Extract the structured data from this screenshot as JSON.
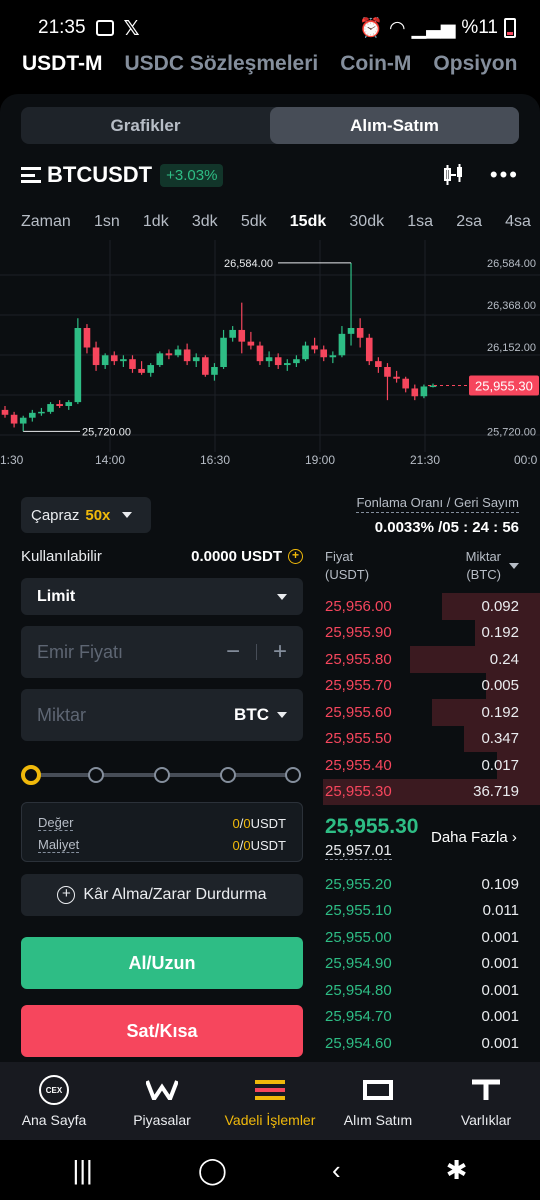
{
  "status_bar": {
    "time": "21:35",
    "battery_text": "%11"
  },
  "market_tabs": [
    "USDT-M",
    "USDC Sözleşmeleri",
    "Coin-M",
    "Opsiyon"
  ],
  "view_toggle": {
    "charts": "Grafikler",
    "trade": "Alım-Satım"
  },
  "pair": {
    "name": "BTCUSDT",
    "change": "+3.03%"
  },
  "intervals": [
    "Zaman",
    "1sn",
    "1dk",
    "3dk",
    "5dk",
    "15dk",
    "30dk",
    "1sa",
    "2sa",
    "4sa"
  ],
  "active_interval": "15dk",
  "chart_data": {
    "type": "candlestick",
    "y_ticks": [
      "26,584.00",
      "26,368.00",
      "26,152.00",
      "25,720.00"
    ],
    "x_ticks": [
      "1:30",
      "14:00",
      "16:30",
      "19:00",
      "21:30",
      "00:0"
    ],
    "high_label": "26,584.00",
    "low_label": "25,720.00",
    "last_price_label": "25,955.30",
    "ylim": [
      25650,
      26650
    ],
    "candles": [
      {
        "o": 25830,
        "h": 25850,
        "l": 25790,
        "c": 25805
      },
      {
        "o": 25805,
        "h": 25820,
        "l": 25740,
        "c": 25760
      },
      {
        "o": 25760,
        "h": 25800,
        "l": 25720,
        "c": 25790
      },
      {
        "o": 25790,
        "h": 25830,
        "l": 25770,
        "c": 25815
      },
      {
        "o": 25815,
        "h": 25840,
        "l": 25800,
        "c": 25820
      },
      {
        "o": 25820,
        "h": 25870,
        "l": 25810,
        "c": 25860
      },
      {
        "o": 25860,
        "h": 25880,
        "l": 25840,
        "c": 25850
      },
      {
        "o": 25850,
        "h": 25880,
        "l": 25830,
        "c": 25870
      },
      {
        "o": 25870,
        "h": 26300,
        "l": 25860,
        "c": 26250
      },
      {
        "o": 26250,
        "h": 26270,
        "l": 26120,
        "c": 26150
      },
      {
        "o": 26150,
        "h": 26180,
        "l": 26030,
        "c": 26060
      },
      {
        "o": 26060,
        "h": 26120,
        "l": 26040,
        "c": 26110
      },
      {
        "o": 26110,
        "h": 26130,
        "l": 26060,
        "c": 26080
      },
      {
        "o": 26080,
        "h": 26110,
        "l": 26050,
        "c": 26090
      },
      {
        "o": 26090,
        "h": 26110,
        "l": 26020,
        "c": 26040
      },
      {
        "o": 26040,
        "h": 26080,
        "l": 26010,
        "c": 26020
      },
      {
        "o": 26020,
        "h": 26070,
        "l": 26000,
        "c": 26060
      },
      {
        "o": 26060,
        "h": 26130,
        "l": 26050,
        "c": 26120
      },
      {
        "o": 26120,
        "h": 26140,
        "l": 26090,
        "c": 26110
      },
      {
        "o": 26110,
        "h": 26160,
        "l": 26100,
        "c": 26140
      },
      {
        "o": 26140,
        "h": 26170,
        "l": 26060,
        "c": 26080
      },
      {
        "o": 26080,
        "h": 26120,
        "l": 26050,
        "c": 26100
      },
      {
        "o": 26100,
        "h": 26110,
        "l": 26000,
        "c": 26010
      },
      {
        "o": 26010,
        "h": 26070,
        "l": 25980,
        "c": 26050
      },
      {
        "o": 26050,
        "h": 26240,
        "l": 26040,
        "c": 26200
      },
      {
        "o": 26200,
        "h": 26260,
        "l": 26180,
        "c": 26240
      },
      {
        "o": 26240,
        "h": 26380,
        "l": 26120,
        "c": 26180
      },
      {
        "o": 26180,
        "h": 26230,
        "l": 26140,
        "c": 26160
      },
      {
        "o": 26160,
        "h": 26180,
        "l": 26060,
        "c": 26080
      },
      {
        "o": 26080,
        "h": 26130,
        "l": 26050,
        "c": 26100
      },
      {
        "o": 26100,
        "h": 26120,
        "l": 26040,
        "c": 26060
      },
      {
        "o": 26060,
        "h": 26090,
        "l": 26030,
        "c": 26070
      },
      {
        "o": 26070,
        "h": 26110,
        "l": 26050,
        "c": 26090
      },
      {
        "o": 26090,
        "h": 26180,
        "l": 26080,
        "c": 26160
      },
      {
        "o": 26160,
        "h": 26200,
        "l": 26120,
        "c": 26140
      },
      {
        "o": 26140,
        "h": 26160,
        "l": 26080,
        "c": 26100
      },
      {
        "o": 26100,
        "h": 26130,
        "l": 26070,
        "c": 26110
      },
      {
        "o": 26110,
        "h": 26260,
        "l": 26100,
        "c": 26220
      },
      {
        "o": 26220,
        "h": 26584,
        "l": 26160,
        "c": 26250
      },
      {
        "o": 26250,
        "h": 26300,
        "l": 26150,
        "c": 26200
      },
      {
        "o": 26200,
        "h": 26220,
        "l": 26060,
        "c": 26080
      },
      {
        "o": 26080,
        "h": 26100,
        "l": 26020,
        "c": 26050
      },
      {
        "o": 26050,
        "h": 26070,
        "l": 25880,
        "c": 26000
      },
      {
        "o": 26000,
        "h": 26030,
        "l": 25970,
        "c": 25990
      },
      {
        "o": 25990,
        "h": 26000,
        "l": 25920,
        "c": 25940
      },
      {
        "o": 25940,
        "h": 25960,
        "l": 25880,
        "c": 25900
      },
      {
        "o": 25900,
        "h": 25960,
        "l": 25890,
        "c": 25950
      },
      {
        "o": 25950,
        "h": 25965,
        "l": 25945,
        "c": 25955
      }
    ]
  },
  "margin": {
    "mode": "Çapraz",
    "leverage": "50x"
  },
  "funding": {
    "label": "Fonlama Oranı / Geri Sayım",
    "value": "0.0033% /05 : 24 : 56"
  },
  "available": {
    "label": "Kullanılabilir",
    "value": "0.0000 USDT"
  },
  "order_type": "Limit",
  "price_input": {
    "placeholder": "Emir Fiyatı",
    "minus": "−",
    "plus": "+"
  },
  "qty_input": {
    "placeholder": "Miktar",
    "unit": "BTC"
  },
  "slider_percent": 0,
  "summary": [
    {
      "label": "Değer",
      "value": "0",
      "value2": "0",
      "unit": "USDT"
    },
    {
      "label": "Maliyet",
      "value": "0",
      "value2": "0",
      "unit": "USDT"
    }
  ],
  "tpsl_label": "Kâr Alma/Zarar Durdurma",
  "buy_label": "Al/Uzun",
  "sell_label": "Sat/Kısa",
  "orderbook": {
    "price_header": "Fiyat",
    "price_unit": "(USDT)",
    "qty_header": "Miktar",
    "qty_unit": "(BTC)",
    "asks": [
      {
        "price": "25,956.00",
        "qty": "0.092",
        "depth": 0.45
      },
      {
        "price": "25,955.90",
        "qty": "0.192",
        "depth": 0.3
      },
      {
        "price": "25,955.80",
        "qty": "0.24",
        "depth": 0.6
      },
      {
        "price": "25,955.70",
        "qty": "0.005",
        "depth": 0.25
      },
      {
        "price": "25,955.60",
        "qty": "0.192",
        "depth": 0.5
      },
      {
        "price": "25,955.50",
        "qty": "0.347",
        "depth": 0.35
      },
      {
        "price": "25,955.40",
        "qty": "0.017",
        "depth": 0.2
      },
      {
        "price": "25,955.30",
        "qty": "36.719",
        "depth": 1.0
      }
    ],
    "last_price": "25,955.30",
    "mark_price": "25,957.01",
    "more_label": "Daha Fazla",
    "bids": [
      {
        "price": "25,955.20",
        "qty": "0.109"
      },
      {
        "price": "25,955.10",
        "qty": "0.011"
      },
      {
        "price": "25,955.00",
        "qty": "0.001"
      },
      {
        "price": "25,954.90",
        "qty": "0.001"
      },
      {
        "price": "25,954.80",
        "qty": "0.001"
      },
      {
        "price": "25,954.70",
        "qty": "0.001"
      },
      {
        "price": "25,954.60",
        "qty": "0.001"
      }
    ]
  },
  "bottom_nav": [
    {
      "label": "Ana Sayfa",
      "icon": "cex-icon"
    },
    {
      "label": "Piyasalar",
      "icon": "markets-icon"
    },
    {
      "label": "Vadeli İşlemler",
      "icon": "futures-icon"
    },
    {
      "label": "Alım Satım",
      "icon": "trade-icon"
    },
    {
      "label": "Varlıklar",
      "icon": "assets-icon"
    }
  ],
  "colors": {
    "green": "#2ebd85",
    "red": "#f6465d",
    "accent": "#f0b90b"
  }
}
